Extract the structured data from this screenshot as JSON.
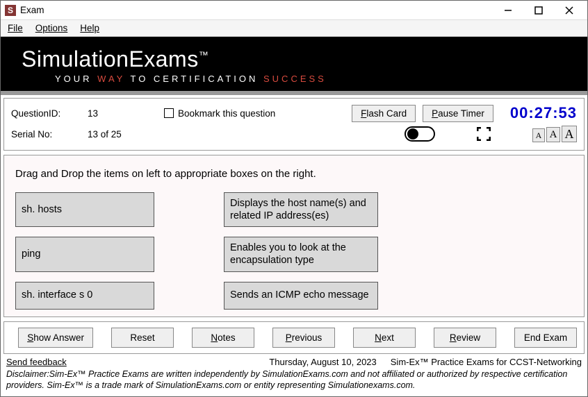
{
  "window": {
    "title": "Exam",
    "icon_letter": "S"
  },
  "menu": {
    "file": "File",
    "options": "Options",
    "help": "Help"
  },
  "banner": {
    "brand": "SimulationExams",
    "tm": "™",
    "tag_a": "YOUR ",
    "tag_b": "WAY",
    "tag_c": " TO CERTIFICATION ",
    "tag_d": "SUCCESS"
  },
  "meta": {
    "qid_label": "QuestionID:",
    "qid_value": "13",
    "bookmark_label": "Bookmark this question",
    "flash_card": "lash Card",
    "flash_card_u": "F",
    "pause_timer": "ause Timer",
    "pause_timer_u": "P",
    "timer": "00:27:53",
    "serial_label": "Serial No:",
    "serial_value": "13 of 25",
    "font_a": "A"
  },
  "question": {
    "prompt": "Drag and Drop the items on left to appropriate boxes on the right.",
    "left": [
      "sh. hosts",
      "ping",
      "sh. interface s 0"
    ],
    "right": [
      "Displays the host name(s) and related IP address(es)",
      "Enables you to look at the encapsulation type",
      "Sends an ICMP echo message"
    ]
  },
  "actions": {
    "show_answer_u": "S",
    "show_answer": "how Answer",
    "reset": "Reset",
    "notes_u": "N",
    "notes": "otes",
    "previous_u": "P",
    "previous": "revious",
    "next_u": "N",
    "next": "ext",
    "review_u": "R",
    "review": "eview",
    "end_exam": "End Exam"
  },
  "footer": {
    "feedback": "Send feedback",
    "date": "Thursday, August 10, 2023",
    "product": "Sim-Ex™ Practice Exams for CCST-Networking",
    "disclaimer": "Disclaimer:Sim-Ex™ Practice Exams are written independently by SimulationExams.com and not affiliated or authorized by respective certification providers. Sim-Ex™ is a trade mark of SimulationExams.com or entity representing Simulationexams.com."
  }
}
